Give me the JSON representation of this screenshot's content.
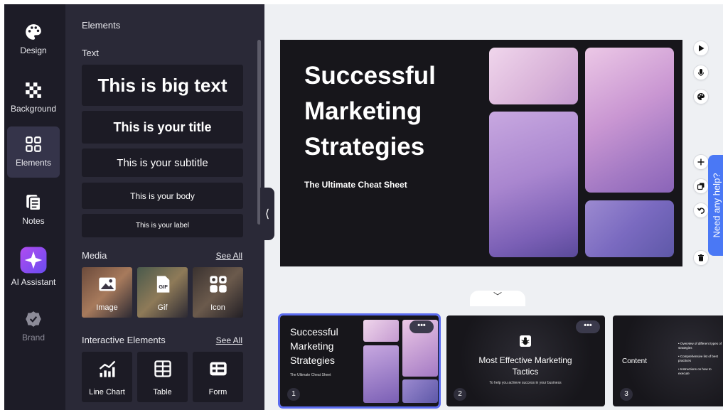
{
  "rail": {
    "items": [
      {
        "label": "Design",
        "icon": "palette-icon"
      },
      {
        "label": "Background",
        "icon": "checkerboard-icon"
      },
      {
        "label": "Elements",
        "icon": "elements-grid-icon"
      },
      {
        "label": "Notes",
        "icon": "notes-icon"
      },
      {
        "label": "AI Assistant",
        "icon": "ai-sparkle-icon"
      },
      {
        "label": "Brand",
        "icon": "brand-badge-icon"
      }
    ],
    "active": "Elements"
  },
  "panel": {
    "title": "Elements",
    "text_section": {
      "label": "Text",
      "buttons": [
        "This is big text",
        "This is your title",
        "This is your subtitle",
        "This is your body",
        "This is your label"
      ]
    },
    "media_section": {
      "label": "Media",
      "see_all": "See All",
      "tiles": [
        {
          "label": "Image",
          "icon": "image-icon"
        },
        {
          "label": "Gif",
          "icon": "gif-icon"
        },
        {
          "label": "Icon",
          "icon": "icon-grid-icon"
        }
      ]
    },
    "interactive_section": {
      "label": "Interactive Elements",
      "see_all": "See All",
      "tiles": [
        {
          "label": "Line Chart",
          "icon": "line-chart-icon"
        },
        {
          "label": "Table",
          "icon": "table-icon"
        },
        {
          "label": "Form",
          "icon": "form-icon"
        }
      ]
    }
  },
  "slide": {
    "title": "Successful Marketing Strategies",
    "subtitle": "The Ultimate Cheat Sheet"
  },
  "tools": [
    "play-icon",
    "microphone-icon",
    "palette-icon",
    "plus-icon",
    "duplicate-icon",
    "undo-icon",
    "trash-icon"
  ],
  "help": {
    "label": "Need any help?"
  },
  "thumbnails": [
    {
      "number": "1",
      "title": "Successful Marketing Strategies",
      "subtitle": "The Ultimate Cheat Sheet",
      "more": "•••"
    },
    {
      "number": "2",
      "title": "Most Effective Marketing Tactics",
      "subtitle": "To help you achieve success in your business",
      "more": "•••"
    },
    {
      "number": "3",
      "title": "Content",
      "bullets": [
        "Overview of different types of strategies",
        "Comprehensive list of best practices",
        "Instructions on how to execute"
      ]
    }
  ],
  "colors": {
    "accent": "#5b6cf0",
    "help": "#4a78f5",
    "panel": "#2a2937",
    "rail": "#1d1c27",
    "slide_bg": "#17161b"
  }
}
